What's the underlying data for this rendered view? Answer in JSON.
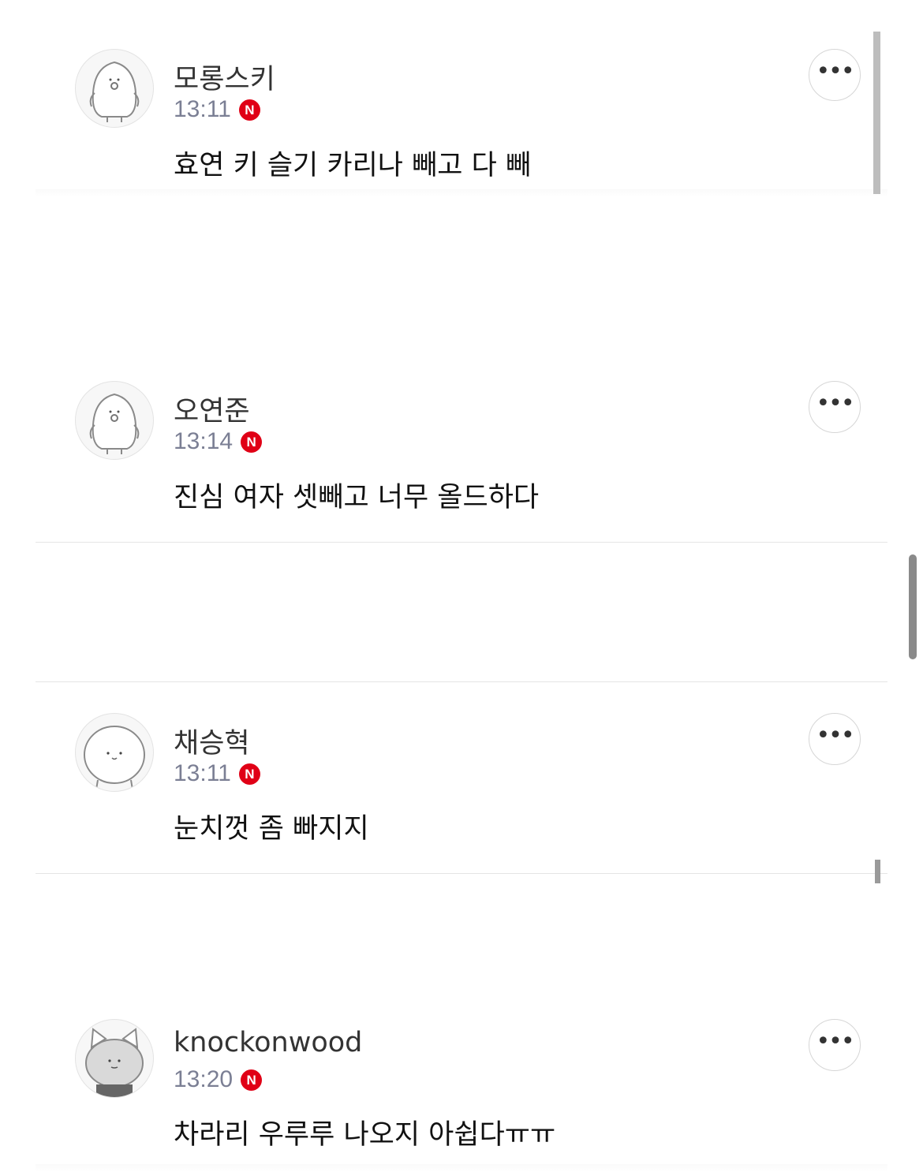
{
  "comments": [
    {
      "author": "모롱스키",
      "time": "13:11",
      "badge": "N",
      "text": "효연 키 슬기 카리나 빼고 다 빼",
      "avatar": "penguin-avatar",
      "more": "•••"
    },
    {
      "author": "오연준",
      "time": "13:14",
      "badge": "N",
      "text": "진심 여자 셋빼고 너무 올드하다",
      "avatar": "penguin-avatar",
      "more": "•••"
    },
    {
      "author": "채승혁",
      "time": "13:11",
      "badge": "N",
      "text": "눈치껏 좀 빠지지",
      "avatar": "round-face-avatar",
      "more": "•••"
    },
    {
      "author": "knockonwood",
      "time": "13:20",
      "badge": "N",
      "text": "차라리 우루루 나오지 아쉽다ㅠㅠ",
      "avatar": "cat-avatar",
      "more": "•••"
    }
  ],
  "colors": {
    "badge": "#e00016",
    "time": "#7b7f94",
    "divider": "#e5e5e5"
  }
}
